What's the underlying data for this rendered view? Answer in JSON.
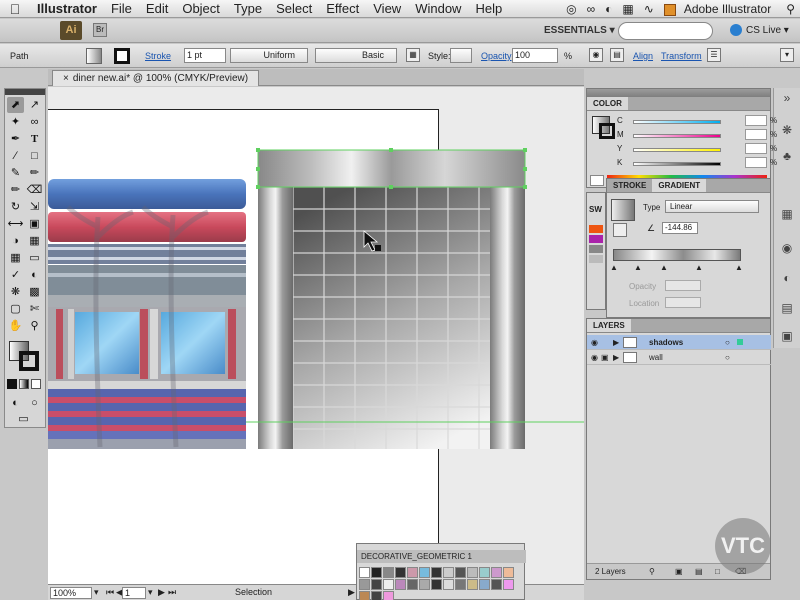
{
  "menubar": {
    "apple": "",
    "app": "Illustrator",
    "items": [
      "File",
      "Edit",
      "Object",
      "Type",
      "Select",
      "Effect",
      "View",
      "Window",
      "Help"
    ],
    "right_app": "Adobe Illustrator"
  },
  "appbar": {
    "logo": "Ai",
    "workspace": "ESSENTIALS ▾",
    "cslive": "CS Live ▾"
  },
  "controlbar": {
    "object_type": "Path",
    "stroke_label": "Stroke",
    "stroke_weight": "1 pt",
    "profile_uniform": "Uniform",
    "brush_basic": "Basic",
    "style_label": "Style:",
    "opacity_label": "Opacity",
    "opacity_value": "100",
    "opacity_unit": "%",
    "align_label": "Align",
    "transform_label": "Transform"
  },
  "document": {
    "tab_title": "diner new.ai* @ 100% (CMYK/Preview)"
  },
  "statusbar": {
    "zoom": "100%",
    "artboard": "1",
    "mode": "Selection"
  },
  "color_panel": {
    "title": "COLOR",
    "channels": [
      {
        "label": "C",
        "unit": "%"
      },
      {
        "label": "M",
        "unit": "%"
      },
      {
        "label": "Y",
        "unit": "%"
      },
      {
        "label": "K",
        "unit": "%"
      }
    ]
  },
  "gradient_panel": {
    "tabs": [
      "STROKE",
      "GRADIENT"
    ],
    "active_tab": "GRADIENT",
    "sw_tab": "SW",
    "type_label": "Type",
    "type_value": "Linear",
    "angle_value": "-144.86",
    "opacity_label": "Opacity",
    "location_label": "Location"
  },
  "layers_panel": {
    "title": "LAYERS",
    "layers": [
      {
        "name": "shadows",
        "selected": true
      },
      {
        "name": "wall",
        "selected": false
      }
    ],
    "footer": "2 Layers"
  },
  "swatch_library": {
    "title": "DECORATIVE_GEOMETRIC 1"
  },
  "watermark": "VTC",
  "colors": {
    "selection_green": "#5fd05f",
    "menu_bg": "#e8e8e8",
    "layer_highlight": "#a7c0e4",
    "accent_blue": "#1a55b0"
  }
}
